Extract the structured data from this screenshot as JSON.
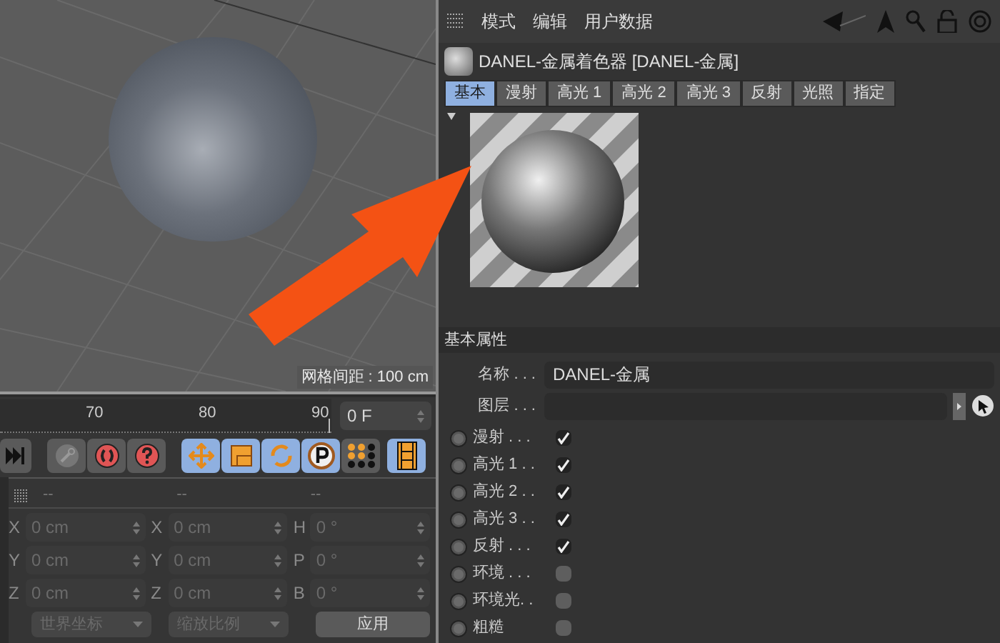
{
  "viewport": {
    "grid_label": "网格间距 : 100 cm"
  },
  "timeline": {
    "ticks": [
      "70",
      "80",
      "90"
    ],
    "frame_field": "0 F"
  },
  "toolbar": {
    "tools": [
      {
        "kind": "end",
        "active": false
      },
      {
        "kind": "key",
        "active": false
      },
      {
        "kind": "record",
        "active": false
      },
      {
        "kind": "help",
        "active": false
      },
      {
        "kind": "move",
        "active": true
      },
      {
        "kind": "scale",
        "active": true
      },
      {
        "kind": "rotate",
        "active": true
      },
      {
        "kind": "point",
        "active": true
      },
      {
        "kind": "dots",
        "active": false
      },
      {
        "kind": "film",
        "active": true
      }
    ]
  },
  "coordinates": {
    "disabled": true,
    "header": [
      "--",
      "--",
      "--"
    ],
    "rows": [
      {
        "axis_a": "X",
        "value_a": "0 cm",
        "axis_b": "X",
        "value_b": "0 cm",
        "axis_c": "H",
        "value_c": "0 °"
      },
      {
        "axis_a": "Y",
        "value_a": "0 cm",
        "axis_b": "Y",
        "value_b": "0 cm",
        "axis_c": "P",
        "value_c": "0 °"
      },
      {
        "axis_a": "Z",
        "value_a": "0 cm",
        "axis_b": "Z",
        "value_b": "0 cm",
        "axis_c": "B",
        "value_c": "0 °"
      }
    ],
    "dropdowns": [
      "世界坐标",
      "缩放比例"
    ],
    "apply_button": "应用"
  },
  "menu": [
    "模式",
    "编辑",
    "用户数据"
  ],
  "material_title": "DANEL-金属着色器 [DANEL-金属]",
  "tabs": [
    {
      "label": "基本",
      "selected": true
    },
    {
      "label": "漫射",
      "selected": false
    },
    {
      "label": "高光 1",
      "selected": false
    },
    {
      "label": "高光 2",
      "selected": false
    },
    {
      "label": "高光 3",
      "selected": false
    },
    {
      "label": "反射",
      "selected": false
    },
    {
      "label": "光照",
      "selected": false
    },
    {
      "label": "指定",
      "selected": false
    }
  ],
  "section_title": "基本属性",
  "fields": [
    {
      "kind": "text",
      "label": "名称 . . .",
      "value": "DANEL-金属"
    },
    {
      "kind": "link",
      "label": "图层 . . ."
    }
  ],
  "channels": [
    {
      "label": "漫射 . . .",
      "checked": true
    },
    {
      "label": "高光 1 . .",
      "checked": true
    },
    {
      "label": "高光 2 . .",
      "checked": true
    },
    {
      "label": "高光 3 . .",
      "checked": true
    },
    {
      "label": "反射 . . .",
      "checked": true
    },
    {
      "label": "环境 . . .",
      "checked": false
    },
    {
      "label": "环境光. .",
      "checked": false
    },
    {
      "label": "粗糙",
      "checked": false
    }
  ]
}
